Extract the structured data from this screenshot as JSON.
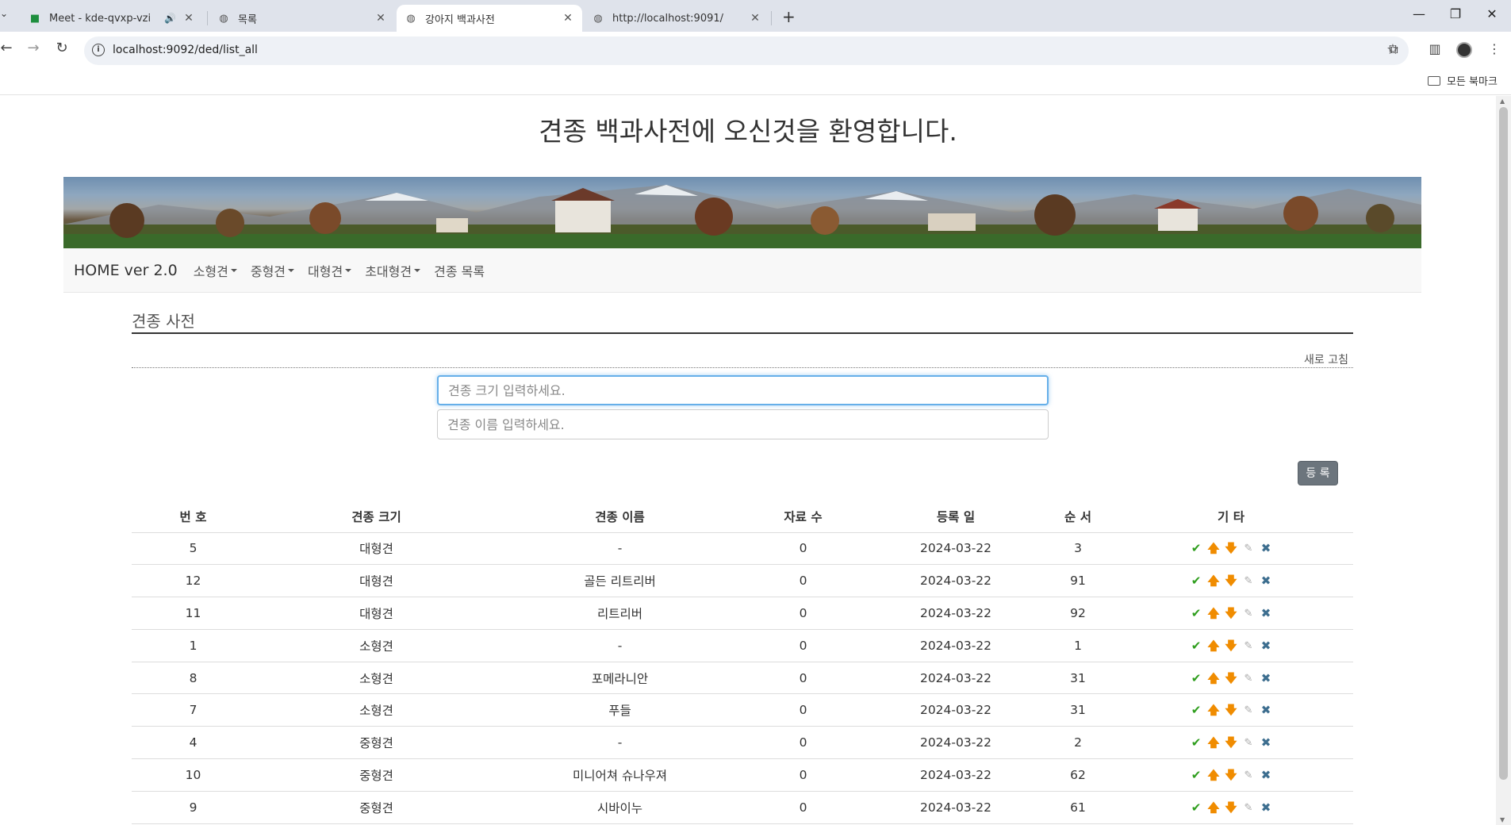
{
  "browser": {
    "tabs": [
      {
        "title": "Meet - kde-qvxp-vzi",
        "active": false
      },
      {
        "title": "목록",
        "active": false
      },
      {
        "title": "강아지 백과사전",
        "active": true
      },
      {
        "title": "http://localhost:9091/",
        "active": false
      }
    ],
    "url": "localhost:9092/ded/list_all",
    "bookmarks_all": "모든 북마크"
  },
  "page": {
    "welcome": "견종 백과사전에 오신것을 환영합니다.",
    "nav": {
      "brand": "HOME ver 2.0",
      "items": [
        "소형견",
        "중형견",
        "대형견",
        "초대형견",
        "견종 목록"
      ]
    },
    "section_title": "견종 사전",
    "refresh_label": "새로 고침",
    "size_input_placeholder": "견종 크기 입력하세요.",
    "name_input_placeholder": "견종 이름 입력하세요.",
    "register_label": "등 록",
    "table": {
      "headers": [
        "번 호",
        "견종 크기",
        "견종 이름",
        "자료 수",
        "등록 일",
        "순 서",
        "기 타"
      ],
      "rows": [
        {
          "no": "5",
          "size": "대형견",
          "name": "-",
          "count": "0",
          "date": "2024-03-22",
          "order": "3"
        },
        {
          "no": "12",
          "size": "대형견",
          "name": "골든 리트리버",
          "count": "0",
          "date": "2024-03-22",
          "order": "91"
        },
        {
          "no": "11",
          "size": "대형견",
          "name": "리트리버",
          "count": "0",
          "date": "2024-03-22",
          "order": "92"
        },
        {
          "no": "1",
          "size": "소형견",
          "name": "-",
          "count": "0",
          "date": "2024-03-22",
          "order": "1"
        },
        {
          "no": "8",
          "size": "소형견",
          "name": "포메라니안",
          "count": "0",
          "date": "2024-03-22",
          "order": "31"
        },
        {
          "no": "7",
          "size": "소형견",
          "name": "푸들",
          "count": "0",
          "date": "2024-03-22",
          "order": "31"
        },
        {
          "no": "4",
          "size": "중형견",
          "name": "-",
          "count": "0",
          "date": "2024-03-22",
          "order": "2"
        },
        {
          "no": "10",
          "size": "중형견",
          "name": "미니어쳐 슈나우져",
          "count": "0",
          "date": "2024-03-22",
          "order": "62"
        },
        {
          "no": "9",
          "size": "중형견",
          "name": "시바이누",
          "count": "0",
          "date": "2024-03-22",
          "order": "61"
        }
      ]
    }
  },
  "colors": {
    "tabbar": "#dfe3eb",
    "check": "#2f9e1e",
    "arrow": "#f08c00",
    "delete": "#3d6e8f",
    "button": "#6c757d"
  }
}
